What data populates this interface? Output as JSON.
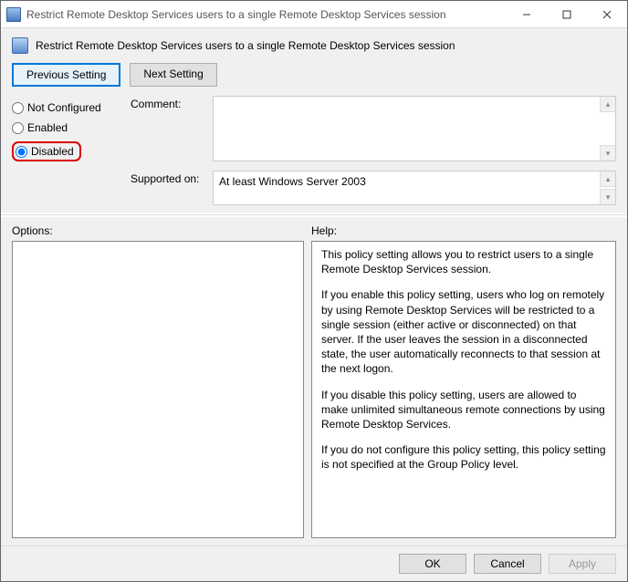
{
  "titlebar": {
    "title": "Restrict Remote Desktop Services users to a single Remote Desktop Services session"
  },
  "header": {
    "title": "Restrict Remote Desktop Services users to a single Remote Desktop Services session"
  },
  "nav": {
    "previous": "Previous Setting",
    "next": "Next Setting"
  },
  "radios": {
    "not_configured": "Not Configured",
    "enabled": "Enabled",
    "disabled": "Disabled",
    "selected": "disabled"
  },
  "fields": {
    "comment_label": "Comment:",
    "comment_value": "",
    "supported_label": "Supported on:",
    "supported_value": "At least Windows Server 2003"
  },
  "panels": {
    "options_label": "Options:",
    "help_label": "Help:",
    "help_p1": "This policy setting allows you to restrict users to a single Remote Desktop Services session.",
    "help_p2": "If you enable this policy setting, users who log on remotely by using Remote Desktop Services will be restricted to a single session (either active or disconnected) on that server. If the user leaves the session in a disconnected state, the user automatically reconnects to that session at the next logon.",
    "help_p3": "If you disable this policy setting, users are allowed to make unlimited simultaneous remote connections by using Remote Desktop Services.",
    "help_p4": "If you do not configure this policy setting,  this policy setting is not specified at the Group Policy level."
  },
  "footer": {
    "ok": "OK",
    "cancel": "Cancel",
    "apply": "Apply"
  }
}
